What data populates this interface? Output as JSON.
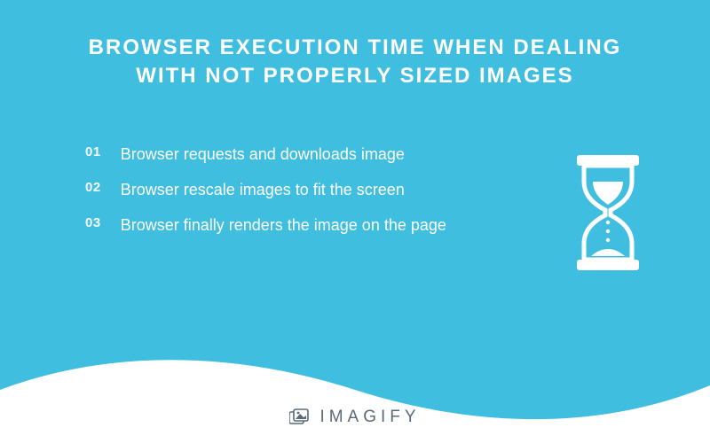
{
  "title": "BROWSER EXECUTION TIME WHEN DEALING WITH NOT PROPERLY SIZED IMAGES",
  "steps": [
    {
      "num": "01",
      "text": "Browser requests and downloads image"
    },
    {
      "num": "02",
      "text": "Browser rescale images to fit the screen"
    },
    {
      "num": "03",
      "text": "Browser finally renders the image on the page"
    }
  ],
  "brand": "IMAGIFY"
}
